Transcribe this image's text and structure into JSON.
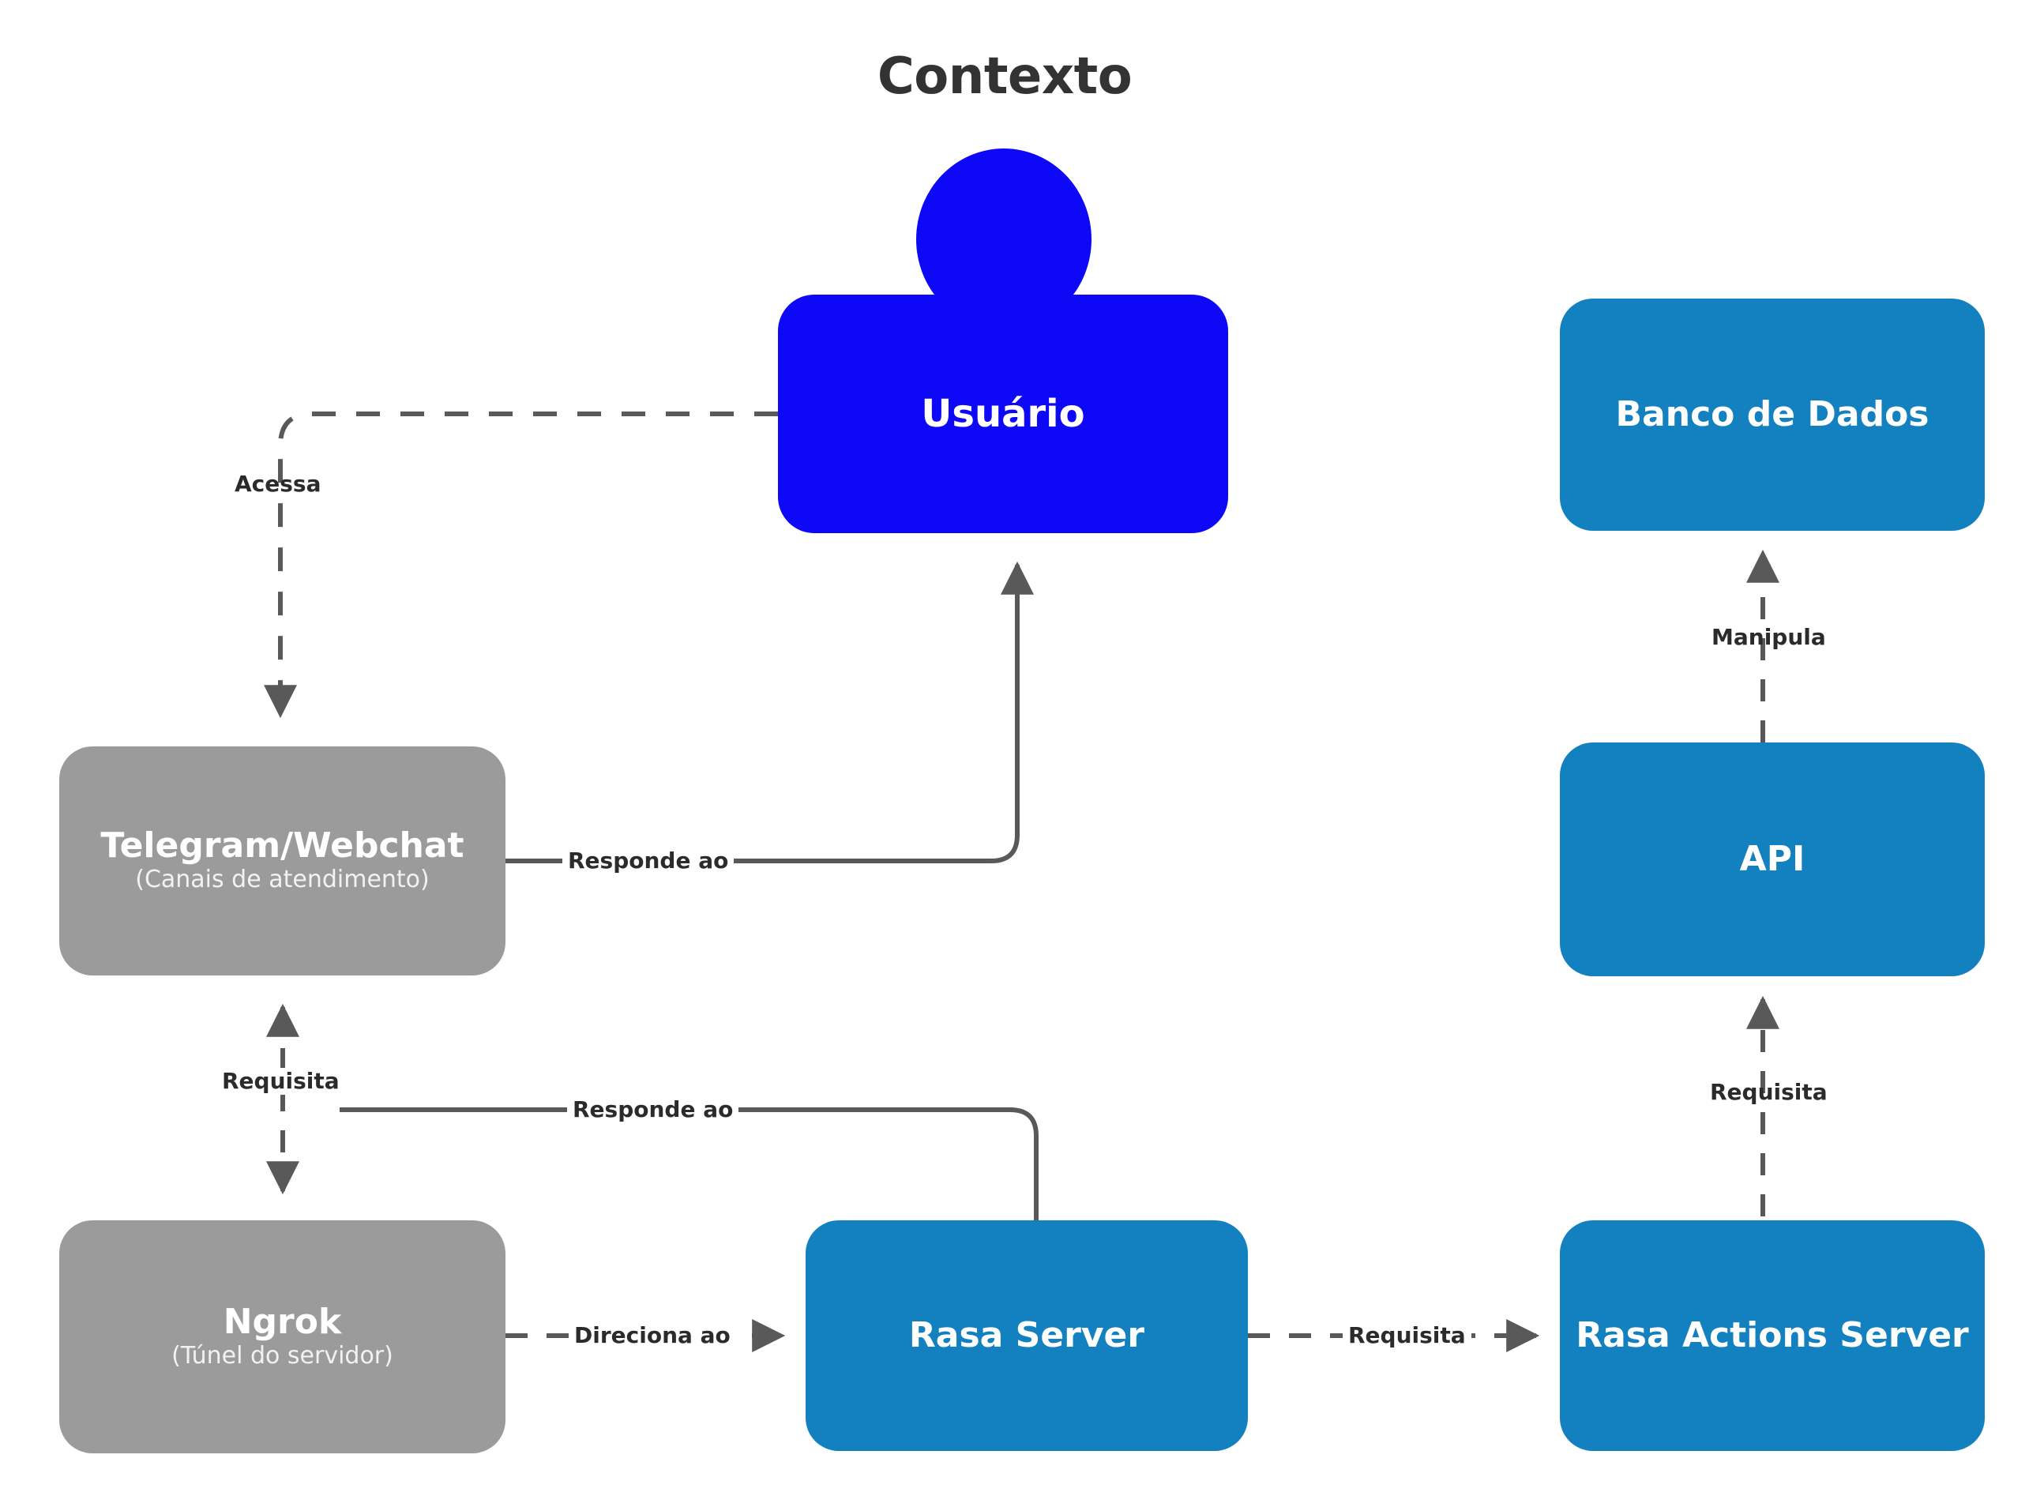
{
  "diagram": {
    "title": "Contexto",
    "background_color": "#ffffff",
    "colors": {
      "actor_blue": "#0d08f5",
      "node_blue": "#1380bf",
      "node_gray": "#9b9b9b",
      "edge_gray": "#595959",
      "title_text": "#333333",
      "node_text": "#ffffff"
    },
    "nodes": [
      {
        "id": "usuario",
        "label": "Usuário",
        "sublabel": "",
        "style": "actor",
        "color": "#0d08f5"
      },
      {
        "id": "telegram",
        "label": "Telegram/Webchat",
        "sublabel": "(Canais de atendimento)",
        "style": "gray",
        "color": "#9b9b9b"
      },
      {
        "id": "ngrok",
        "label": "Ngrok",
        "sublabel": "(Túnel do servidor)",
        "style": "gray",
        "color": "#9b9b9b"
      },
      {
        "id": "rasa_server",
        "label": "Rasa Server",
        "sublabel": "",
        "style": "blue",
        "color": "#1380bf"
      },
      {
        "id": "banco",
        "label": "Banco de Dados",
        "sublabel": "",
        "style": "blue",
        "color": "#1380bf"
      },
      {
        "id": "api",
        "label": "API",
        "sublabel": "",
        "style": "blue",
        "color": "#1380bf"
      },
      {
        "id": "actions",
        "label": "Rasa Actions Server",
        "sublabel": "",
        "style": "blue",
        "color": "#1380bf"
      }
    ],
    "edges": [
      {
        "id": "acessa",
        "label": "Acessa",
        "from": "usuario",
        "to": "telegram",
        "line": "dashed",
        "arrow": "single"
      },
      {
        "id": "responde_user",
        "label": "Responde ao",
        "from": "telegram",
        "to": "usuario",
        "line": "solid",
        "arrow": "single"
      },
      {
        "id": "requisita_ngrok",
        "label": "Requisita",
        "from": "telegram",
        "to": "ngrok",
        "line": "dashed",
        "arrow": "double"
      },
      {
        "id": "responde_tg",
        "label": "Responde ao",
        "from": "rasa_server",
        "to": "telegram",
        "line": "solid",
        "arrow": "none"
      },
      {
        "id": "direciona",
        "label": "Direciona ao",
        "from": "ngrok",
        "to": "rasa_server",
        "line": "dashed",
        "arrow": "single"
      },
      {
        "id": "requisita_act",
        "label": "Requisita",
        "from": "rasa_server",
        "to": "actions",
        "line": "dashed",
        "arrow": "single"
      },
      {
        "id": "requisita_api",
        "label": "Requisita",
        "from": "actions",
        "to": "api",
        "line": "dashed",
        "arrow": "single"
      },
      {
        "id": "manipula",
        "label": "Manipula",
        "from": "api",
        "to": "banco",
        "line": "dashed",
        "arrow": "single"
      }
    ]
  }
}
